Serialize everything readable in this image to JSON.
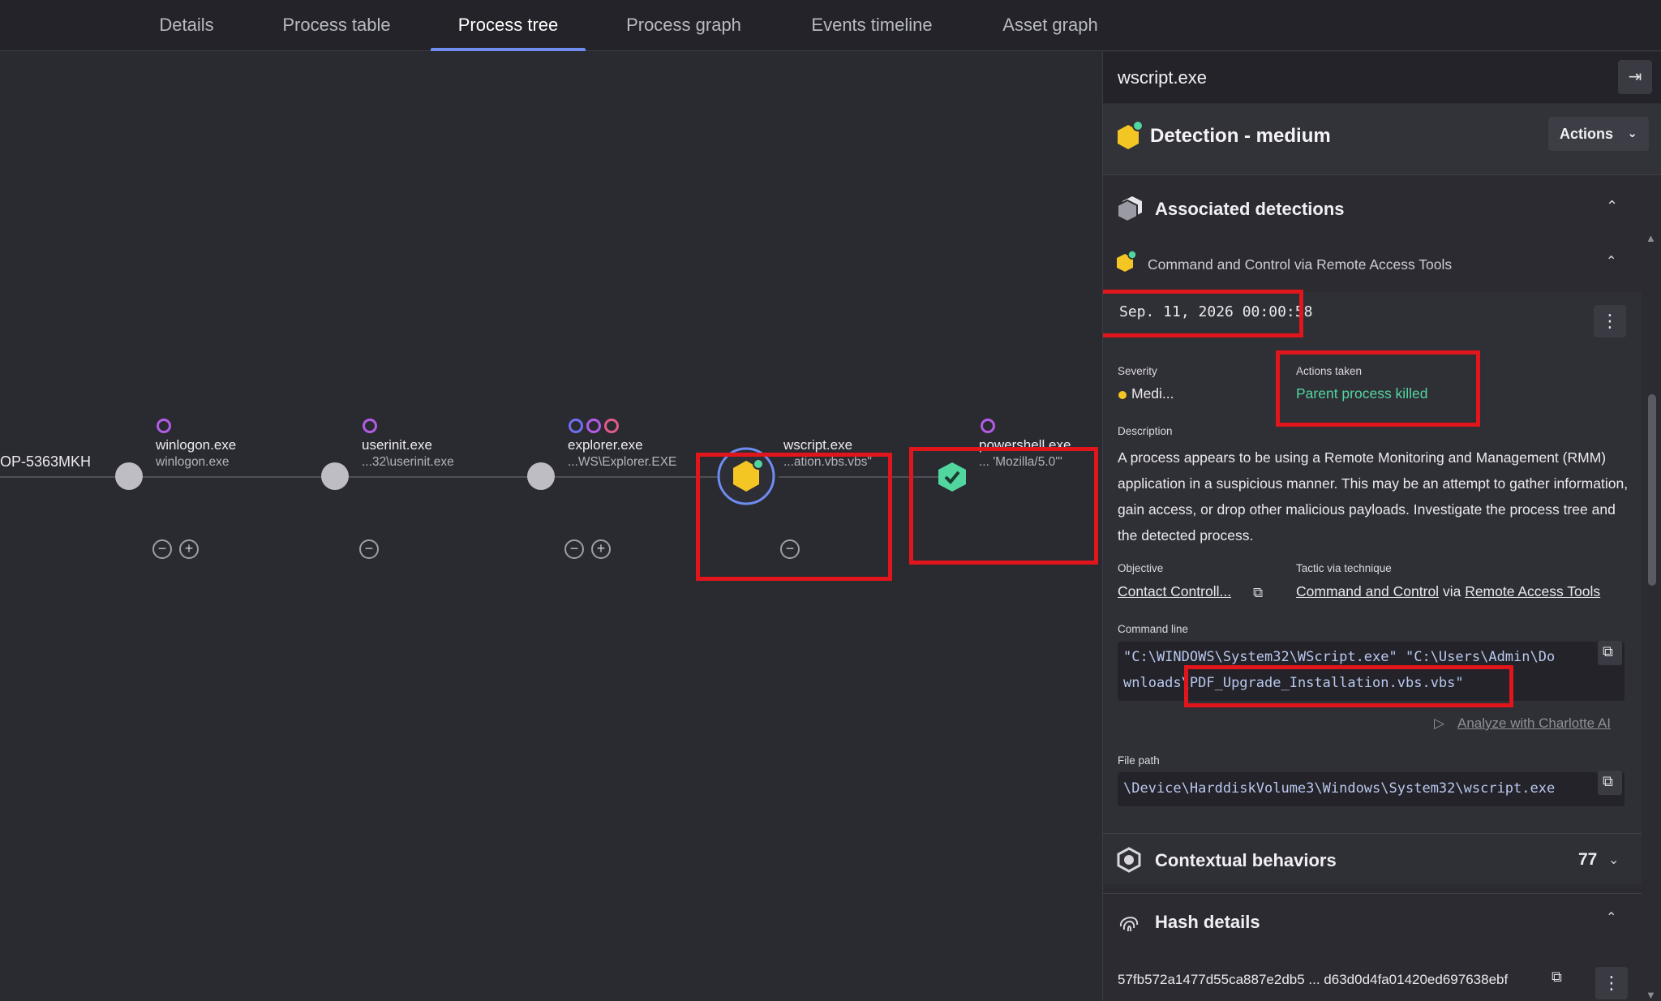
{
  "tabs": [
    {
      "label": "Details"
    },
    {
      "label": "Process table"
    },
    {
      "label": "Process tree",
      "active": true
    },
    {
      "label": "Process graph"
    },
    {
      "label": "Events timeline"
    },
    {
      "label": "Asset graph"
    }
  ],
  "tree": {
    "host_label": "OP-5363MKH",
    "nodes": [
      {
        "name": "winlogon.exe",
        "sub": "winlogon.exe"
      },
      {
        "name": "userinit.exe",
        "sub": "...32\\userinit.exe"
      },
      {
        "name": "explorer.exe",
        "sub": "...WS\\Explorer.EXE"
      },
      {
        "name": "wscript.exe",
        "sub": "...ation.vbs.vbs\""
      },
      {
        "name": "powershell.exe",
        "sub": "... 'Mozilla/5.0'\""
      }
    ]
  },
  "panel": {
    "title": "wscript.exe",
    "detection_title": "Detection - medium",
    "actions_label": "Actions",
    "associated_title": "Associated detections",
    "detection_name": "Command and Control via Remote Access Tools",
    "timestamp": "Sep. 11, 2026 00:00:58",
    "severity_label": "Severity",
    "severity_value": "Medi...",
    "actions_taken_label": "Actions taken",
    "actions_taken_value": "Parent process killed",
    "description_label": "Description",
    "description": "A process appears to be using a Remote Monitoring and Management (RMM) application in a suspicious manner. This may be an attempt to gather information, gain access, or drop other malicious payloads. Investigate the process tree and the detected process.",
    "objective_label": "Objective",
    "objective_value": "Contact Controll...",
    "tactic_label": "Tactic via technique",
    "tactic_value": "Command and Control",
    "tactic_via": "via",
    "technique_value": "Remote Access Tools",
    "cmd_label": "Command line",
    "cmd_line1": "\"C:\\WINDOWS\\System32\\WScript.exe\" \"C:\\Users\\Admin\\Do",
    "cmd_line2_prefix": "wnloads\\",
    "cmd_line2_rest": "PDF_Upgrade_Installation.vbs.vbs\"",
    "analyze_label": "Analyze with Charlotte AI",
    "filepath_label": "File path",
    "filepath_value": "\\Device\\HarddiskVolume3\\Windows\\System32\\wscript.exe",
    "contextual_title": "Contextual behaviors",
    "contextual_count": "77",
    "hash_title": "Hash details",
    "hash_value": "57fb572a1477d55ca887e2db5 ... d63d0d4fa01420ed697638ebf"
  },
  "colors": {
    "accent": "#6f8cf0",
    "medium": "#f3c623",
    "success": "#52d6a0",
    "highlight": "#e0161c",
    "purple": "#b35ce6"
  }
}
